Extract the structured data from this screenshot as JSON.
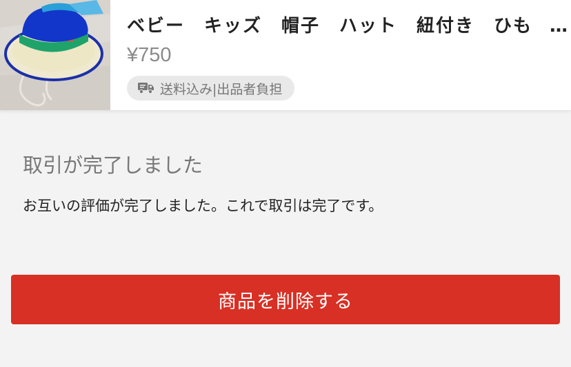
{
  "item": {
    "title": "ベビー　キッズ　帽子　ハット　紐付き　ひも …",
    "price": "¥750",
    "shipping_badge": "送料込み|出品者負担",
    "shipping_icon": "truck-icon",
    "image_icon": "hat-photo"
  },
  "status": {
    "title": "取引が完了しました",
    "message": "お互いの評価が完了しました。これで取引は完了です。"
  },
  "actions": {
    "delete_label": "商品を削除する"
  },
  "colors": {
    "accent": "#d83025",
    "background": "#f3f3f3",
    "badge_bg": "#e9e9e9"
  }
}
